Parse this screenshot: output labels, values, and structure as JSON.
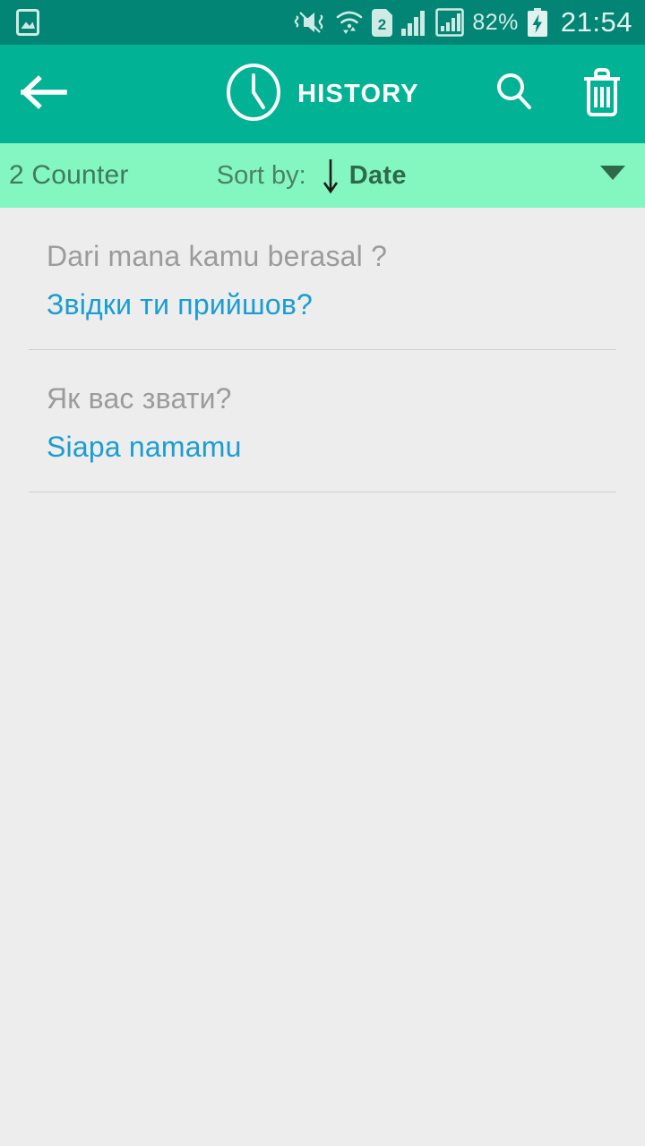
{
  "statusbar": {
    "left_icons": [
      {
        "name": "gallery-image-icon"
      }
    ],
    "right_icons": [
      {
        "name": "mute-vibrate-icon"
      },
      {
        "name": "wifi-data-transfer-icon"
      },
      {
        "name": "sim-2-icon",
        "label": "2"
      },
      {
        "name": "signal-bars-sim1-icon"
      },
      {
        "name": "signal-bars-sim2-icon"
      }
    ],
    "battery_percent": "82%",
    "battery_icon": "battery-charging-icon",
    "clock": "21:54"
  },
  "appbar": {
    "back_icon": "arrow-left-icon",
    "clock_icon": "clock-icon",
    "title": "HISTORY",
    "search_icon": "search-icon",
    "delete_icon": "trash-icon"
  },
  "sortbar": {
    "counter": "2 Counter",
    "sort_label": "Sort by:",
    "sort_direction_icon": "arrow-down-icon",
    "sort_value": "Date",
    "dropdown_icon": "chevron-down-icon"
  },
  "history": {
    "items": [
      {
        "source": "Dari mana kamu berasal ?",
        "target": "Звідки ти прийшов?"
      },
      {
        "source": "Як вас звати?",
        "target": "Siapa namamu"
      }
    ]
  },
  "colors": {
    "statusbar_bg": "#028574",
    "appbar_bg": "#02b295",
    "sortbar_bg": "#84f6bf",
    "page_bg": "#ededed",
    "source_text": "#9b9b9b",
    "target_text": "#1a9dd4",
    "counter_text": "#3f7a5c",
    "sort_value_text": "#2e6a4a"
  }
}
